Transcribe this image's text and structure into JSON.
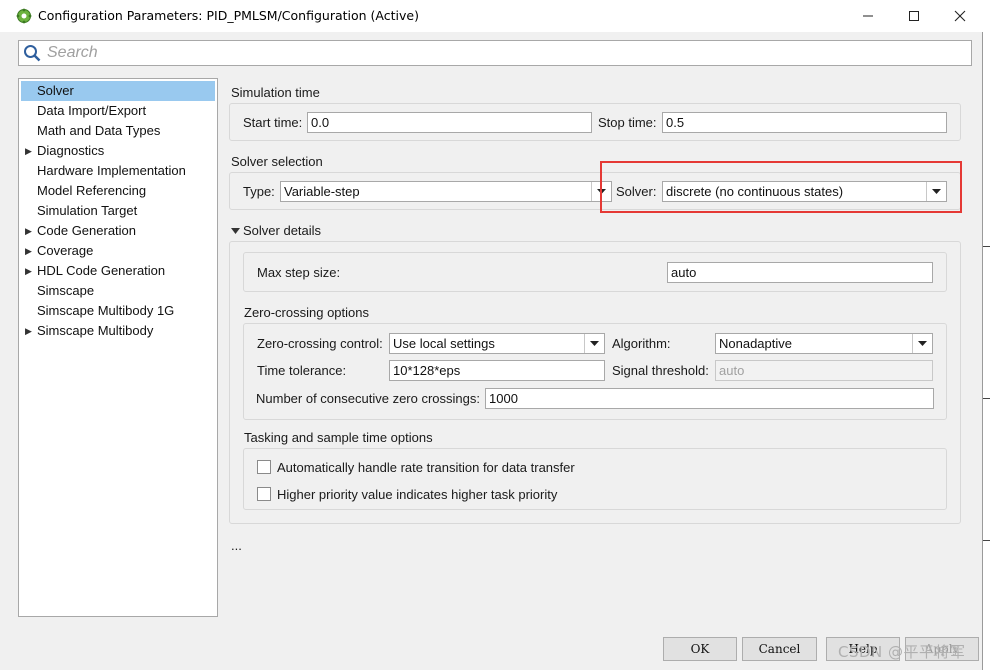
{
  "window": {
    "title": "Configuration Parameters: PID_PMLSM/Configuration (Active)",
    "min_glyph": "—",
    "max_glyph": "☐",
    "close_glyph": "✕"
  },
  "search": {
    "placeholder": "Search"
  },
  "tree": {
    "items": [
      {
        "label": "Solver",
        "selected": true,
        "expandable": false
      },
      {
        "label": "Data Import/Export",
        "expandable": false
      },
      {
        "label": "Math and Data Types",
        "expandable": false
      },
      {
        "label": "Diagnostics",
        "expandable": true
      },
      {
        "label": "Hardware Implementation",
        "expandable": false
      },
      {
        "label": "Model Referencing",
        "expandable": false
      },
      {
        "label": "Simulation Target",
        "expandable": false
      },
      {
        "label": "Code Generation",
        "expandable": true
      },
      {
        "label": "Coverage",
        "expandable": true
      },
      {
        "label": "HDL Code Generation",
        "expandable": true
      },
      {
        "label": "Simscape",
        "expandable": false
      },
      {
        "label": "Simscape Multibody 1G",
        "expandable": false
      },
      {
        "label": "Simscape Multibody",
        "expandable": true
      }
    ]
  },
  "simulation_time": {
    "title": "Simulation time",
    "start_label": "Start time:",
    "start_value": "0.0",
    "stop_label": "Stop time:",
    "stop_value": "0.5"
  },
  "solver_selection": {
    "title": "Solver selection",
    "type_label": "Type:",
    "type_value": "Variable-step",
    "solver_label": "Solver:",
    "solver_value": "discrete (no continuous states)"
  },
  "solver_details": {
    "title": "Solver details",
    "max_step_label": "Max step size:",
    "max_step_value": "auto"
  },
  "zero_crossing": {
    "title": "Zero-crossing options",
    "control_label": "Zero-crossing control:",
    "control_value": "Use local settings",
    "algorithm_label": "Algorithm:",
    "algorithm_value": "Nonadaptive",
    "tolerance_label": "Time tolerance:",
    "tolerance_value": "10*128*eps",
    "threshold_label": "Signal threshold:",
    "threshold_value": "auto",
    "consecutive_label": "Number of consecutive zero crossings:",
    "consecutive_value": "1000"
  },
  "tasking": {
    "title": "Tasking and sample time options",
    "auto_rate_label": "Automatically handle rate transition for data transfer",
    "auto_rate_checked": false,
    "priority_label": "Higher priority value indicates higher task priority",
    "priority_checked": false
  },
  "ellipsis": "...",
  "footer": {
    "ok_label": "OK",
    "cancel_label": "Cancel",
    "help_label": "Help",
    "apply_label": "Apply"
  },
  "watermark": "CSDN @平平将军",
  "colors": {
    "selection": "#99c9ef",
    "highlight": "#e53935",
    "window_bg": "#f0f0f0"
  }
}
